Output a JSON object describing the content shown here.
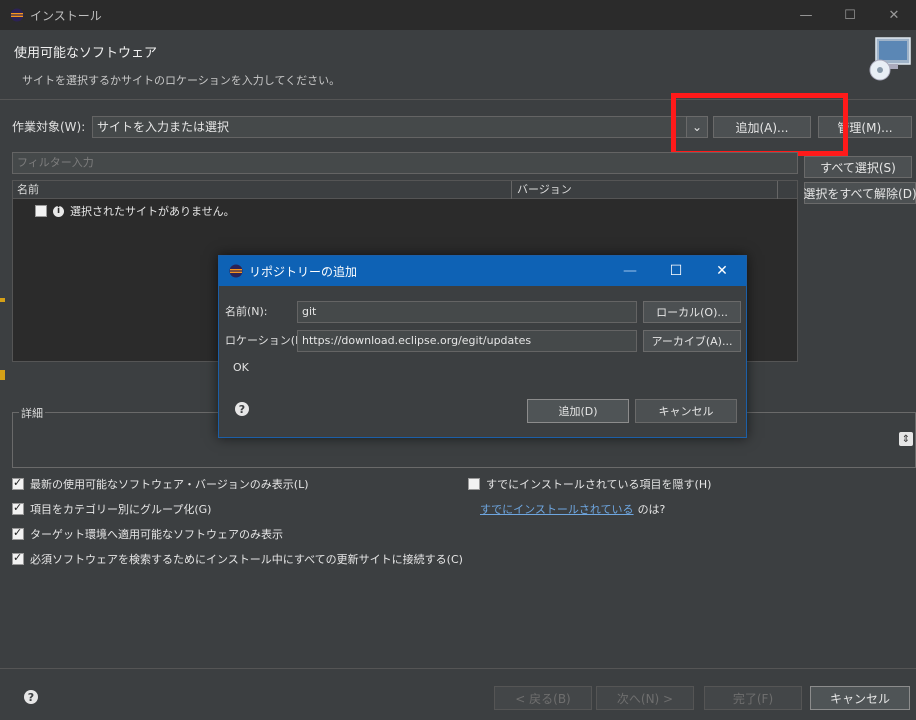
{
  "window": {
    "title": "インストール",
    "minimize": "—",
    "maximize": "☐",
    "close": "✕"
  },
  "header": {
    "title": "使用可能なソフトウェア",
    "description": "サイトを選択するかサイトのロケーションを入力してください。"
  },
  "work": {
    "label": "作業対象(W):",
    "combo_value": "サイトを入力または選択",
    "add_button": "追加(A)...",
    "manage_button": "管理(M)..."
  },
  "filter": {
    "placeholder": "フィルター入力"
  },
  "side_buttons": {
    "select_all": "すべて選択(S)",
    "deselect_all": "選択をすべて解除(D)"
  },
  "tree": {
    "columns": [
      "名前",
      "バージョン"
    ],
    "empty_message": "選択されたサイトがありません。"
  },
  "details": {
    "legend": "詳細"
  },
  "options": {
    "latest_only": "最新の使用可能なソフトウェア・バージョンのみ表示(L)",
    "group_by_category": "項目をカテゴリー別にグループ化(G)",
    "target_env_only": "ターゲット環境へ適用可能なソフトウェアのみ表示",
    "contact_all_sites": "必須ソフトウェアを検索するためにインストール中にすべての更新サイトに接続する(C)",
    "hide_installed": "すでにインストールされている項目を隠す(H)",
    "installed_link": "すでにインストールされている",
    "installed_suffix": "のは?"
  },
  "footer": {
    "back": "< 戻る(B)",
    "next": "次へ(N) >",
    "finish": "完了(F)",
    "cancel": "キャンセル"
  },
  "dialog": {
    "title": "リポジトリーの追加",
    "name_label": "名前(N):",
    "name_value": "git",
    "local_button": "ローカル(O)...",
    "location_label": "ロケーション(L):",
    "location_value": "https://download.eclipse.org/egit/updates",
    "archive_button": "アーカイブ(A)...",
    "status": "OK",
    "add_button": "追加(D)",
    "cancel_button": "キャンセル",
    "minimize": "—",
    "maximize": "☐",
    "close": "✕"
  },
  "colors": {
    "background": "#3c3f41",
    "dialog_title": "#0e62b5",
    "highlight": "#ff1a1a",
    "link": "#6ea6e0"
  }
}
